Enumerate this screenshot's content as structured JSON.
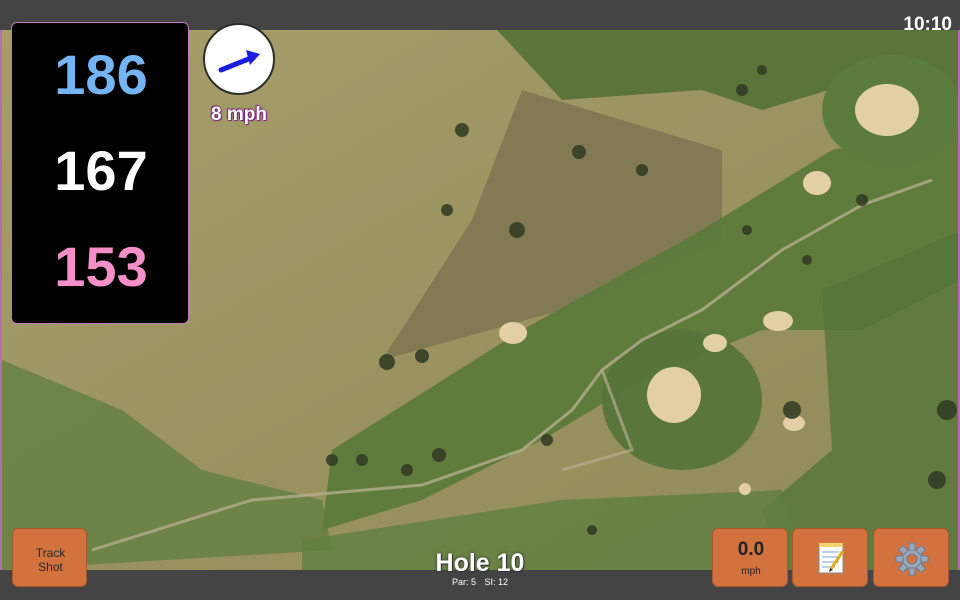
{
  "status_bar": {
    "time": "10:10"
  },
  "distances": {
    "back": "186",
    "middle": "167",
    "front": "153",
    "colors": {
      "back": "#74b4f2",
      "middle": "#ffffff",
      "front": "#f48fc8"
    }
  },
  "wind": {
    "speed": "8 mph",
    "arrow_icon": "wind-direction-arrow",
    "arrow_color": "#1a1ee0"
  },
  "buttons": {
    "track_shot": {
      "line1": "Track",
      "line2": "Shot"
    },
    "speed": {
      "value": "0.0",
      "unit": "mph"
    },
    "notes_icon": "notepad-icon",
    "settings_icon": "gear-icon",
    "color": "#d2733f"
  },
  "hole": {
    "title": "Hole 10",
    "par": "Par: 5",
    "si": "SI: 12"
  },
  "map": {
    "type": "satellite",
    "fairway_color": "#5a7a3a",
    "rough_color": "#9c9663",
    "bunker_color": "#e2cfa6"
  }
}
